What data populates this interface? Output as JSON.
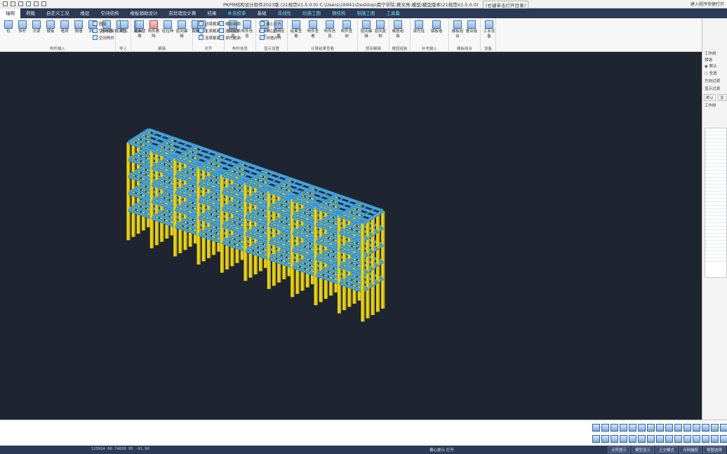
{
  "window": {
    "title": "PKPM结构设计软件2023版 (21规范V1.5.0.0) C:\\Users\\16941\\Desktop\\南宁学院-黄文亮-模型\\模型版本(21规范V1.5.0.0)",
    "hint": "[右键单击打开目录]",
    "right_text": "建入程序快捷打开"
  },
  "menu": {
    "items": [
      "轴网",
      "荷载",
      "自定义工况",
      "楼层",
      "空间结构",
      "楼板辅助设计",
      "前处理及计算",
      "结果",
      "补充校审",
      "基础",
      "非线性",
      "砼施工图",
      "钢结构",
      "钢施工图",
      "工具集"
    ],
    "active_index": 0,
    "highlighted": [
      8,
      10,
      11,
      12,
      13,
      14
    ]
  },
  "ribbon": {
    "groups": [
      {
        "label": "构件输入",
        "buttons": [
          "柱",
          "斜杆",
          "次梁",
          "楼板",
          "墙洞",
          "隔墙",
          "洞口",
          "墙布置",
          "截面图"
        ]
      },
      {
        "label": "导入",
        "buttons": [
          "导入",
          "截面"
        ]
      },
      {
        "label": "编辑",
        "buttons": [
          "截面替换",
          "构件删除",
          "柱拉伸",
          "层间编辑",
          "截面"
        ]
      },
      {
        "label": "对齐",
        "buttons": [
          "偏心对齐"
        ]
      },
      {
        "label": "构件信息",
        "buttons": [
          "本层信息",
          "构件信息"
        ]
      },
      {
        "label": "显示设置",
        "buttons": [
          "截面尺寸",
          "显示设置"
        ]
      },
      {
        "label": "计算结果查看",
        "buttons": [
          "结果查看",
          "构件查看",
          "构件信息",
          "构件查询"
        ]
      },
      {
        "label": "层间编辑",
        "buttons": [
          "层间编辑",
          "层间复制"
        ]
      },
      {
        "label": "楼层组装",
        "buttons": [
          "楼层组装"
        ]
      },
      {
        "label": "补充输入",
        "buttons": [
          "梁托柱",
          "钢板墙"
        ]
      },
      {
        "label": "楼板组合",
        "buttons": [
          "楼板组合",
          "叠合板"
        ]
      },
      {
        "label": "设备",
        "buttons": [
          "工业设备"
        ]
      }
    ],
    "small_items": [
      "圆梁",
      "空间构架",
      "空间构件",
      "偏心对齐",
      "中心对齐",
      "对墙对齐",
      "边梁截面",
      "主梁截面",
      "连梁截面",
      "楼层截面",
      "连梁截面",
      "梁托截面"
    ]
  },
  "right_panel": {
    "title": "工作树",
    "filter_label": "筛选",
    "options": [
      "默认",
      "全选"
    ],
    "direction_label": "方向过滤",
    "sub_label": "显示过滤",
    "tabs": [
      "默认",
      "显"
    ],
    "tree_tab": "工作树"
  },
  "status": {
    "coords": "125914 66.74839 95 -91.90",
    "prompt": "偏心提示 打开",
    "buttons": [
      "点阵提示",
      "模型显示",
      "正交模式",
      "点网捕捉",
      "视图选择"
    ]
  },
  "colors": {
    "menubar": "#2b3a55",
    "viewport": "#1e2530",
    "beam": "#4aa3d8",
    "beam_dark": "#2f7fb3",
    "column": "#e6d21a",
    "column_dark": "#b9a40c"
  }
}
